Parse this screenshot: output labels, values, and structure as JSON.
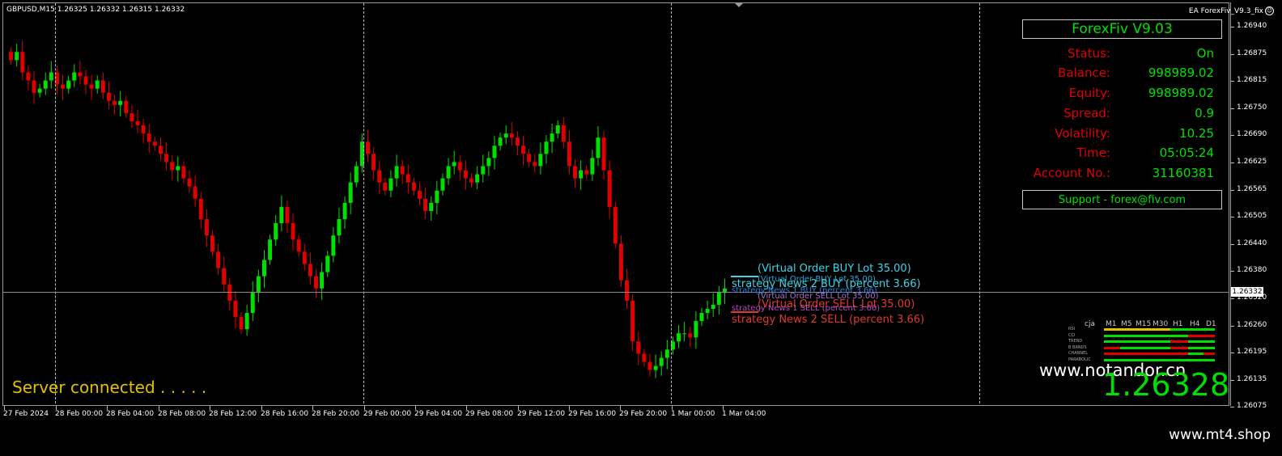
{
  "chart": {
    "symbol_line": "GBPUSD,M15  1.26325 1.26332 1.26315 1.26332",
    "ea_label": "EA ForexFiv_V9.3_fix",
    "ea_face_icon": "smiley-icon",
    "current_price_tag": "1.26332",
    "price_labels": [
      "1.26940",
      "1.26875",
      "1.26815",
      "1.26750",
      "1.26690",
      "1.26625",
      "1.26565",
      "1.26505",
      "1.26440",
      "1.26380",
      "1.26320",
      "1.26260",
      "1.26195",
      "1.26135",
      "1.26075"
    ],
    "time_labels": [
      "27 Feb 2024",
      "28 Feb 00:00",
      "28 Feb 04:00",
      "28 Feb 08:00",
      "28 Feb 12:00",
      "28 Feb 16:00",
      "28 Feb 20:00",
      "29 Feb 00:00",
      "29 Feb 04:00",
      "29 Feb 08:00",
      "29 Feb 12:00",
      "29 Feb 16:00",
      "29 Feb 20:00",
      "1 Mar 00:00",
      "1 Mar 04:00"
    ],
    "colors": {
      "bull": "#00e000",
      "bear": "#e00000",
      "background": "#000000"
    },
    "candle_closes": [
      1.2689,
      1.2691,
      1.2686,
      1.2684,
      1.2681,
      1.2682,
      1.2684,
      1.2686,
      1.2683,
      1.2682,
      1.2684,
      1.2686,
      1.2685,
      1.2683,
      1.2682,
      1.2684,
      1.2681,
      1.2679,
      1.2678,
      1.2679,
      1.2676,
      1.2674,
      1.2673,
      1.2671,
      1.2669,
      1.2668,
      1.2666,
      1.2664,
      1.2662,
      1.2663,
      1.266,
      1.2658,
      1.2655,
      1.265,
      1.2646,
      1.2642,
      1.2638,
      1.2634,
      1.263,
      1.2626,
      1.2623,
      1.2627,
      1.2632,
      1.2636,
      1.264,
      1.2645,
      1.2649,
      1.2653,
      1.2649,
      1.2645,
      1.2642,
      1.2639,
      1.2636,
      1.2633,
      1.2637,
      1.2641,
      1.2646,
      1.265,
      1.2654,
      1.2659,
      1.2663,
      1.2669,
      1.2666,
      1.2662,
      1.2659,
      1.2657,
      1.266,
      1.2663,
      1.2661,
      1.2659,
      1.2657,
      1.2655,
      1.2652,
      1.2654,
      1.2657,
      1.266,
      1.2663,
      1.2664,
      1.2662,
      1.266,
      1.2659,
      1.2661,
      1.2663,
      1.2665,
      1.2668,
      1.267,
      1.2671,
      1.267,
      1.2668,
      1.2666,
      1.2664,
      1.2663,
      1.2666,
      1.2669,
      1.2671,
      1.2673,
      1.2669,
      1.2663,
      1.266,
      1.2662,
      1.2661,
      1.2665,
      1.267,
      1.2662,
      1.2653,
      1.2644,
      1.2635,
      1.263,
      1.262,
      1.2617,
      1.2615,
      1.2613,
      1.2614,
      1.2616,
      1.2618,
      1.262,
      1.2622,
      1.2622,
      1.2621,
      1.2625,
      1.2627,
      1.2628,
      1.2629,
      1.2632,
      1.2633
    ],
    "horizontal_line_price": 1.26332
  },
  "panel": {
    "title": "ForexFiv  V9.03",
    "rows": [
      {
        "key": "Status:",
        "value": "On"
      },
      {
        "key": "Balance:",
        "value": "998989.02"
      },
      {
        "key": "Equity:",
        "value": "998989.02"
      },
      {
        "key": "Spread:",
        "value": "0.9"
      },
      {
        "key": "Volatility:",
        "value": "10.25"
      },
      {
        "key": "Time:",
        "value": "05:05:24"
      },
      {
        "key": "Account No.:",
        "value": "31160381"
      }
    ],
    "support": "Support - forex@fiv.com"
  },
  "orders": {
    "virtual_buy": "(Virtual Order BUY Lot 35.00)",
    "virtual_buy_small": "(Virtual Order BUY Lot 35.00)",
    "news1_buy": "strategy News 1 BUY (percent 3.66)",
    "news2_buy": "strategy News 2 BUY (percent 3.66)",
    "virtual_sell_small": "(Virtual Order SELL Lot 35.00)",
    "virtual_sell": "(Virtual Order SELL Lot 35.00)",
    "news1_sell": "strategy News 1 SELL (percent 3.66)",
    "news2_sell": "strategy News 2 SELL (percent 3.66)"
  },
  "indicator": {
    "corner": "cja",
    "timeframes": [
      "M1",
      "M5",
      "M15",
      "M30",
      "H1",
      "H4",
      "D1"
    ],
    "rows": [
      "RSI",
      "CCI",
      "TREND",
      "B BANDS",
      "CHANNEL",
      "PARABOLIC"
    ]
  },
  "watermark": "www.notandor.cn",
  "big_price": "1.26328",
  "server_status": "Server connected . . . . .",
  "site": "www.mt4.shop"
}
